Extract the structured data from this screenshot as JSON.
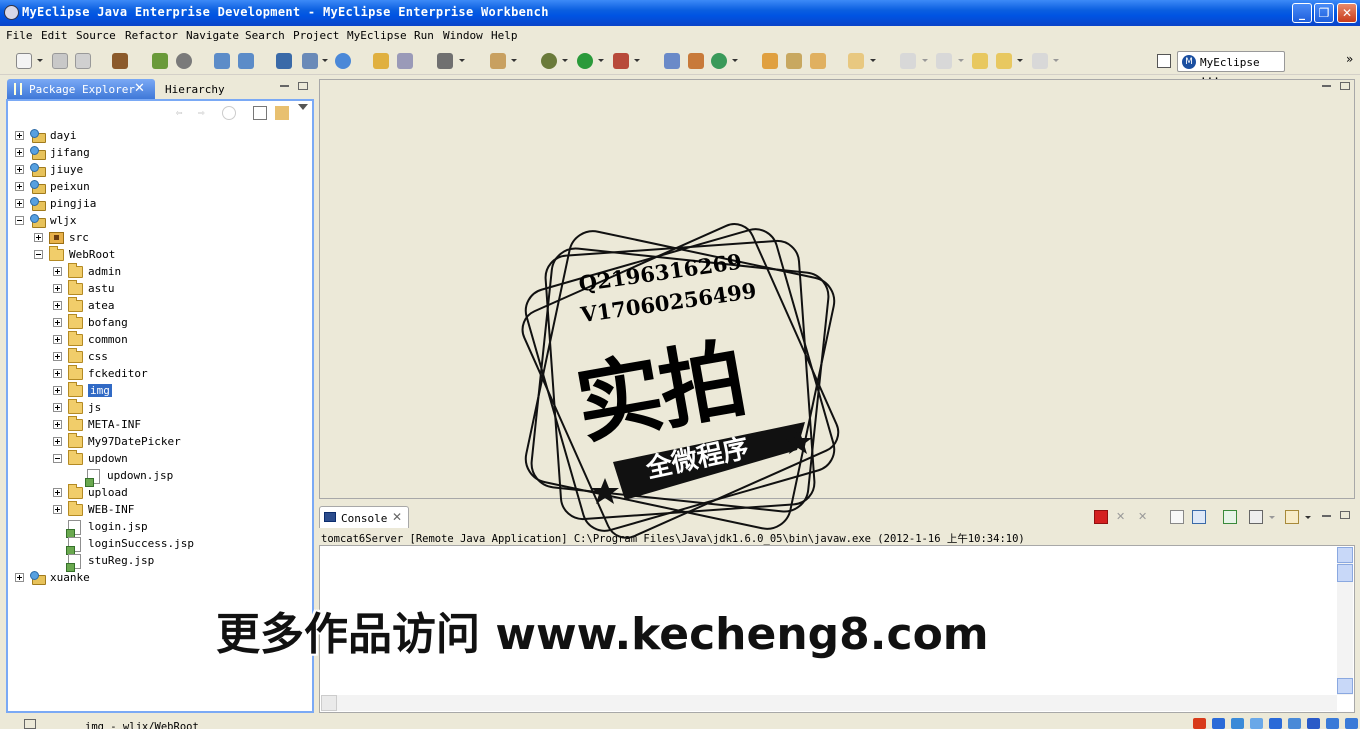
{
  "window": {
    "title": "MyEclipse Java Enterprise Development - MyEclipse Enterprise Workbench",
    "min_glyph": "_",
    "max_glyph": "❐",
    "close_glyph": "✕"
  },
  "menu": [
    "File",
    "Edit",
    "Source",
    "Refactor",
    "Navigate",
    "Search",
    "Project",
    "MyEclipse",
    "Run",
    "Window",
    "Help"
  ],
  "toolbar": {
    "perspective_label": "MyEclipse ...",
    "perspective_glyph": "M",
    "more_glyph": "»"
  },
  "package_explorer": {
    "tab_label": "Package Explorer",
    "close_glyph": "✕",
    "hierarchy_label": "Hierarchy",
    "tree": [
      {
        "label": "dayi",
        "type": "project",
        "expanded": false
      },
      {
        "label": "jifang",
        "type": "project",
        "expanded": false
      },
      {
        "label": "jiuye",
        "type": "project",
        "expanded": false
      },
      {
        "label": "peixun",
        "type": "project",
        "expanded": false
      },
      {
        "label": "pingjia",
        "type": "project",
        "expanded": false
      },
      {
        "label": "wljx",
        "type": "project",
        "expanded": true
      },
      {
        "label": "src",
        "type": "src",
        "expanded": false
      },
      {
        "label": "WebRoot",
        "type": "folder",
        "expanded": true
      },
      {
        "label": "admin",
        "type": "folder",
        "expanded": false
      },
      {
        "label": "astu",
        "type": "folder",
        "expanded": false
      },
      {
        "label": "atea",
        "type": "folder",
        "expanded": false
      },
      {
        "label": "bofang",
        "type": "folder",
        "expanded": false
      },
      {
        "label": "common",
        "type": "folder",
        "expanded": false
      },
      {
        "label": "css",
        "type": "folder",
        "expanded": false
      },
      {
        "label": "fckeditor",
        "type": "folder",
        "expanded": false
      },
      {
        "label": "img",
        "type": "folder",
        "expanded": false,
        "selected": true
      },
      {
        "label": "js",
        "type": "folder",
        "expanded": false
      },
      {
        "label": "META-INF",
        "type": "folder",
        "expanded": false
      },
      {
        "label": "My97DatePicker",
        "type": "folder",
        "expanded": false
      },
      {
        "label": "updown",
        "type": "folder",
        "expanded": true
      },
      {
        "label": "updown.jsp",
        "type": "jsp"
      },
      {
        "label": "upload",
        "type": "folder",
        "expanded": false
      },
      {
        "label": "WEB-INF",
        "type": "folder",
        "expanded": false
      },
      {
        "label": "login.jsp",
        "type": "jsp"
      },
      {
        "label": "loginSuccess.jsp",
        "type": "jsp"
      },
      {
        "label": "stuReg.jsp",
        "type": "jsp"
      },
      {
        "label": "xuanke",
        "type": "project",
        "expanded": false
      }
    ]
  },
  "console": {
    "tab_label": "Console",
    "close_glyph": "✕",
    "description": "tomcat6Server [Remote Java Application] C:\\Program Files\\Java\\jdk1.6.0_05\\bin\\javaw.exe (2012-1-16 上午10:34:10)"
  },
  "status": {
    "text": "img - wljx/WebRoot"
  },
  "watermark": {
    "line1": "Q2196316269",
    "line2": "V17060256499",
    "big": "实拍",
    "ribbon": "全微程序",
    "promo": "更多作品访问 www.kecheng8.com"
  },
  "colors": {
    "title_bar": "#0054e3",
    "active_tab": "#3f78d8",
    "selection": "#316ac5",
    "chrome": "#ece9d8",
    "terminate": "#d42020"
  }
}
